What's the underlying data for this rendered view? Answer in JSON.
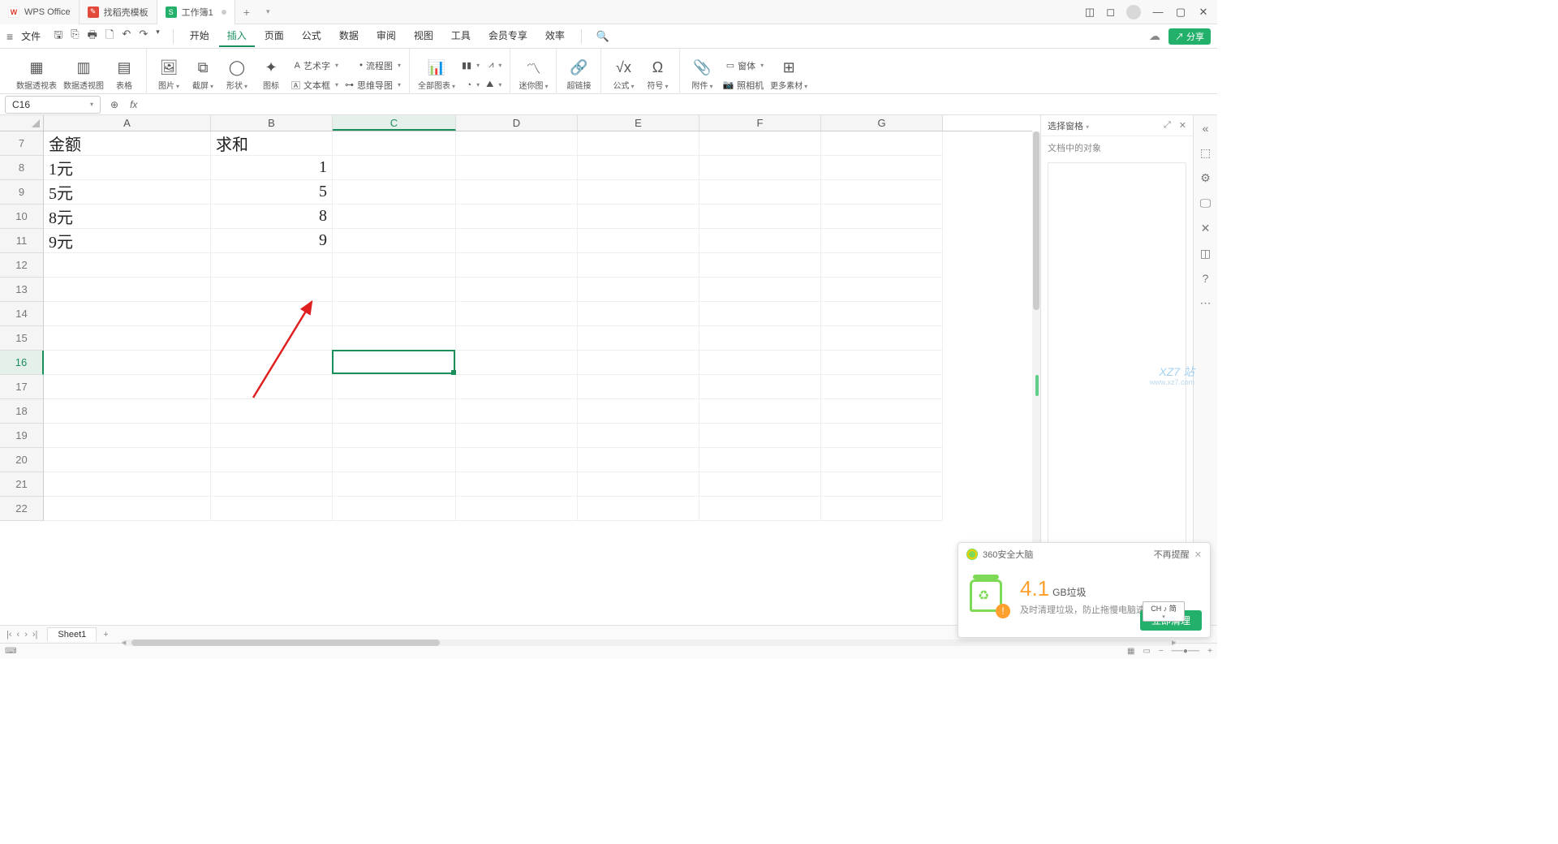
{
  "titlebar": {
    "app_tab": "WPS Office",
    "template_tab": "找稻壳模板",
    "doc_tab": "工作簿1",
    "plus": "+"
  },
  "menurow": {
    "file": "文件",
    "tabs": [
      "开始",
      "插入",
      "页面",
      "公式",
      "数据",
      "审阅",
      "视图",
      "工具",
      "会员专享",
      "效率"
    ],
    "active_index": 1,
    "share": "分享"
  },
  "ribbon": {
    "pivot_table": "数据透视表",
    "pivot_chart": "数据透视图",
    "table": "表格",
    "picture": "图片",
    "screenshot": "截屏",
    "shapes": "形状",
    "icons": "图标",
    "wordart": "艺术字",
    "flowchart": "流程图",
    "textbox": "文本框",
    "mindmap": "思维导图",
    "all_charts": "全部图表",
    "mini_chart": "迷你图",
    "hyperlink": "超链接",
    "formula": "公式",
    "symbol": "符号",
    "attachment": "附件",
    "camera": "照相机",
    "more": "更多素材"
  },
  "fbar": {
    "cell_ref": "C16"
  },
  "grid": {
    "cols": [
      "A",
      "B",
      "C",
      "D",
      "E",
      "F",
      "G"
    ],
    "row_start": 7,
    "row_end": 22,
    "selected_cell": "C16",
    "data": {
      "A7": "金额",
      "B7": "求和",
      "A8": "1元",
      "B8": "1",
      "A9": "5元",
      "B9": "5",
      "A10": "8元",
      "B10": "8",
      "A11": "9元",
      "B11": "9"
    }
  },
  "sidepanel": {
    "title": "选择窗格",
    "label": "文档中的对象"
  },
  "sheetbar": {
    "sheet": "Sheet1"
  },
  "popup": {
    "brand": "360安全大脑",
    "dismiss": "不再提醒",
    "value": "4.1",
    "unit": "GB垃圾",
    "sub": "及时清理垃圾，防止拖慢电脑速度",
    "action": "立即清理"
  },
  "ime": {
    "line1": "CH ♪ 简"
  },
  "watermark": {
    "a": "XZ7 站",
    "b": "www.xz7.com"
  }
}
